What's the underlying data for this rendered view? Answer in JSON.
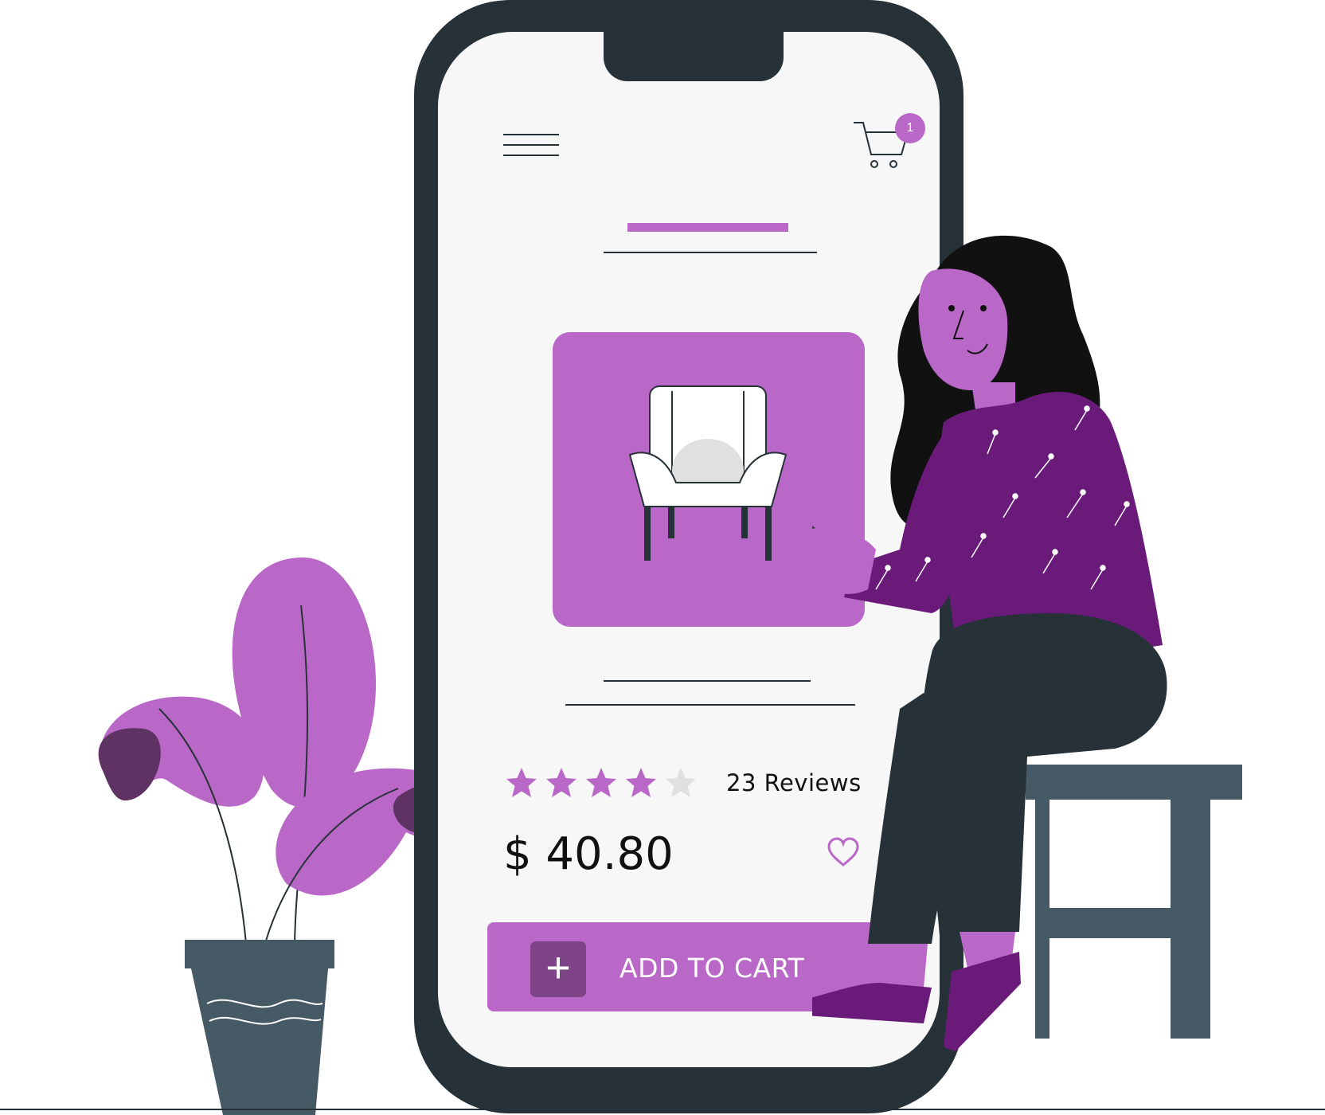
{
  "colors": {
    "accent": "#ba68c8",
    "accent_dark": "#7e4487",
    "plant_dark": "#5e3363",
    "phone": "#263238",
    "screen": "#f7f7f7",
    "shirt": "#6a1b7a",
    "pants": "#263238",
    "stool": "#455a64",
    "star_off": "#e0e0e0"
  },
  "header": {
    "menu_icon": "hamburger-menu-icon",
    "cart_icon": "shopping-cart-icon",
    "cart_count": "1"
  },
  "product": {
    "image_icon": "armchair-icon",
    "rating": 4,
    "rating_max": 5,
    "reviews_label": "23 Reviews",
    "price": "$ 40.80",
    "favorite_icon": "heart-outline-icon"
  },
  "actions": {
    "add_to_cart_label": "ADD TO CART",
    "add_icon": "plus-icon"
  }
}
